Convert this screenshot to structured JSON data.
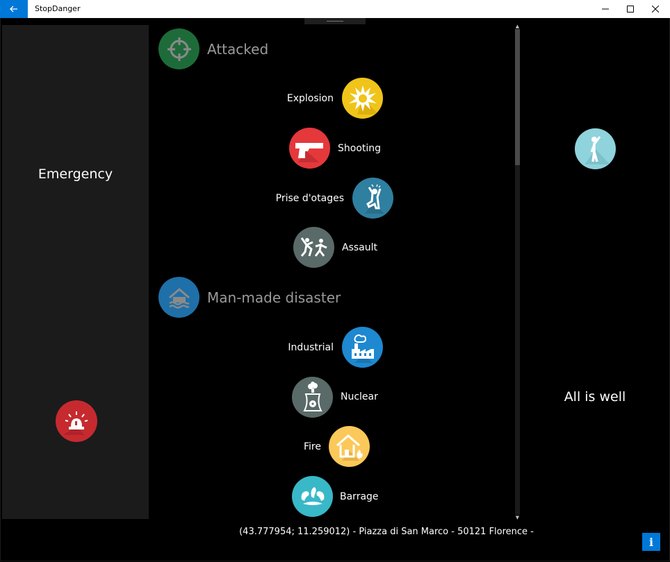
{
  "window": {
    "title": "StopDanger",
    "back_icon": "back-arrow-icon",
    "controls": [
      "minimize-icon",
      "maximize-icon",
      "close-icon"
    ]
  },
  "emergency": {
    "label": "Emergency",
    "icon": "siren-icon",
    "color": "#c62a2f"
  },
  "all_is_well": {
    "label": "All is well",
    "icon": "standing-person-icon",
    "color": "#8fd3dc"
  },
  "categories": [
    {
      "label": "Attacked",
      "icon": "crosshair-icon",
      "color": "#1e6b3a",
      "items": [
        {
          "label": "Explosion",
          "icon": "explosion-icon",
          "color": "#f0c419"
        },
        {
          "label": "Shooting",
          "icon": "pistol-icon",
          "color": "#e5383b"
        },
        {
          "label": "Prise d'otages",
          "icon": "hostage-icon",
          "color": "#2f7fa0"
        },
        {
          "label": "Assault",
          "icon": "fighting-people-icon",
          "color": "#596a68"
        }
      ]
    },
    {
      "label": "Man-made disaster",
      "icon": "flooded-house-icon",
      "color": "#1f6fa8",
      "items": [
        {
          "label": "Industrial",
          "icon": "factory-icon",
          "color": "#1e88d0"
        },
        {
          "label": "Nuclear",
          "icon": "nuclear-plant-icon",
          "color": "#596a68"
        },
        {
          "label": "Fire",
          "icon": "house-fire-icon",
          "color": "#fbc85a"
        },
        {
          "label": "Barrage",
          "icon": "water-splash-icon",
          "color": "#39b8c8"
        }
      ]
    }
  ],
  "location": {
    "text": "(43.777954; 11.259012) - Piazza di San Marco - 50121 Florence -"
  },
  "info_button": {
    "label": "i"
  }
}
